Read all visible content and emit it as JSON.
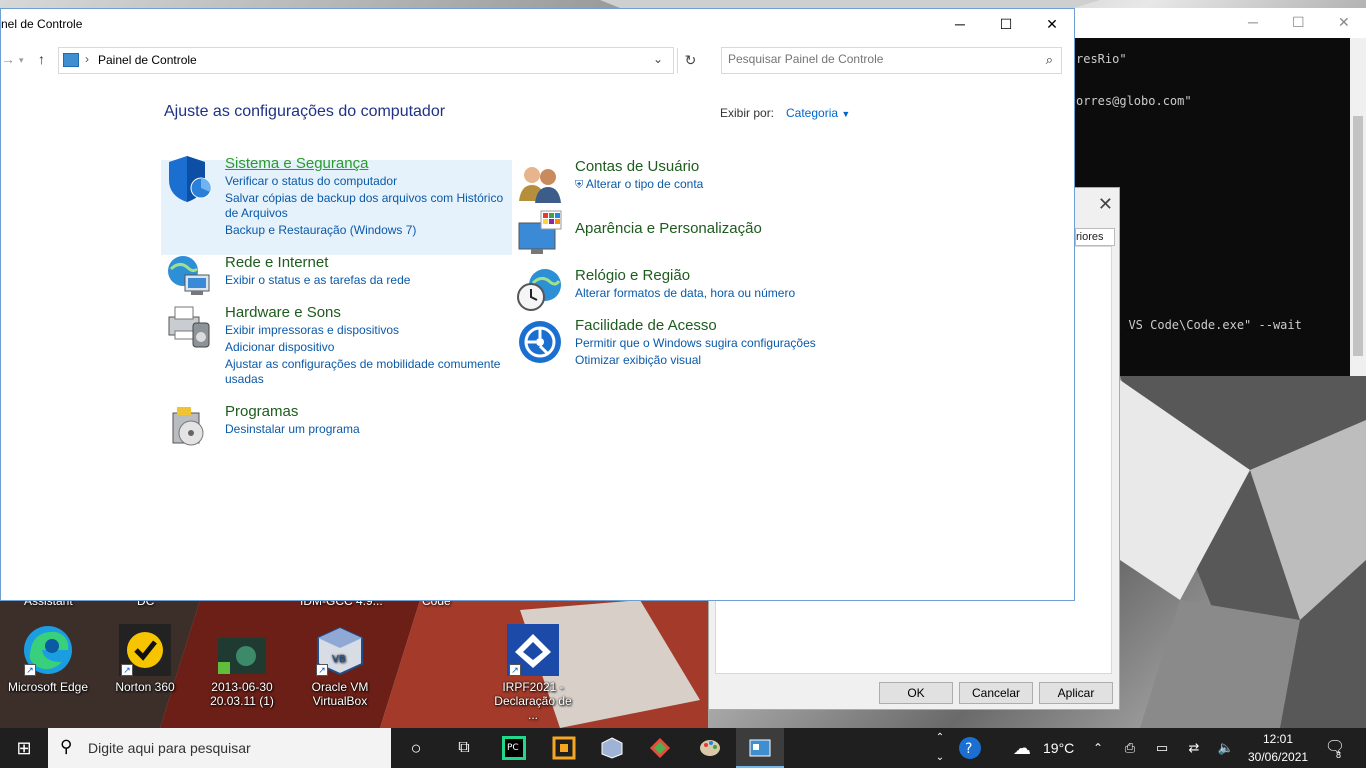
{
  "window": {
    "title": "nel de Controle",
    "minimize_icon": "minimize-icon",
    "maximize_icon": "maximize-icon",
    "close_icon": "close-icon"
  },
  "address_bar": {
    "path": "Painel de Controle"
  },
  "search": {
    "placeholder": "Pesquisar Painel de Controle"
  },
  "main": {
    "heading": "Ajuste as configurações do computador",
    "view_by_label": "Exibir por:",
    "view_by_value": "Categoria"
  },
  "categories_left": [
    {
      "title": "Sistema e Segurança",
      "icon": "shield-icon",
      "links": [
        "Verificar o status do computador",
        "Salvar cópias de backup dos arquivos com Histórico de Arquivos",
        "Backup e Restauração (Windows 7)"
      ]
    },
    {
      "title": "Rede e Internet",
      "icon": "network-globe-icon",
      "links": [
        "Exibir o status e as tarefas da rede"
      ]
    },
    {
      "title": "Hardware e Sons",
      "icon": "printer-speaker-icon",
      "links": [
        "Exibir impressoras e dispositivos",
        "Adicionar dispositivo",
        "Ajustar as configurações de mobilidade comumente usadas"
      ]
    },
    {
      "title": "Programas",
      "icon": "programs-disc-icon",
      "links": [
        "Desinstalar um programa"
      ]
    }
  ],
  "categories_right": [
    {
      "title": "Contas de Usuário",
      "icon": "users-icon",
      "links": [
        "Alterar o tipo de conta"
      ]
    },
    {
      "title": "Aparência e Personalização",
      "icon": "monitor-palette-icon",
      "links": []
    },
    {
      "title": "Relógio e Região",
      "icon": "clock-globe-icon",
      "links": [
        "Alterar formatos de data, hora ou número"
      ]
    },
    {
      "title": "Facilidade de Acesso",
      "icon": "accessibility-icon",
      "links": [
        "Permitir que o Windows sugira configurações",
        "Otimizar exibição visual"
      ]
    }
  ],
  "terminal": {
    "lines": [
      "resRio\"",
      "orres@globo.com\"",
      "t VS Code\\Code.exe\" --wait"
    ]
  },
  "dialog": {
    "tab_label": "riores",
    "ok": "OK",
    "cancel": "Cancelar",
    "apply": "Aplicar"
  },
  "desktop": {
    "cut_labels": [
      "Assistant",
      "DC",
      "IDM-GCC 4.9...",
      "Code"
    ],
    "icons": [
      {
        "label": "Microsoft Edge",
        "icon": "edge-icon"
      },
      {
        "label": "Norton 360",
        "icon": "norton-icon"
      },
      {
        "label": "2013-06-30 20.03.11 (1)",
        "icon": "image-file-icon"
      },
      {
        "label": "Oracle VM VirtualBox",
        "icon": "virtualbox-icon"
      },
      {
        "label": "IRPF2021 - Declaração de ...",
        "icon": "irpf-icon"
      }
    ]
  },
  "taskbar": {
    "search_placeholder": "Digite aqui para pesquisar",
    "temperature": "19°C",
    "time": "12:01",
    "date": "30/06/2021",
    "notifications": "8"
  }
}
